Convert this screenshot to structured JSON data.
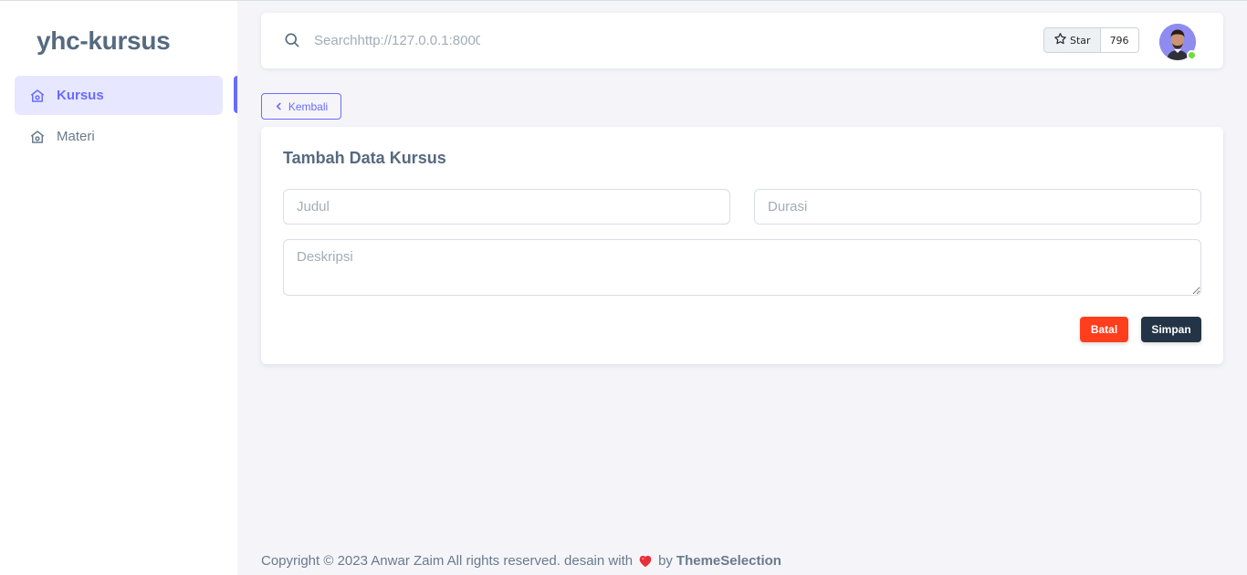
{
  "brand": "yhc-kursus",
  "sidebar": {
    "items": [
      {
        "label": "Kursus",
        "icon": "home-icon",
        "active": true
      },
      {
        "label": "Materi",
        "icon": "home-icon",
        "active": false
      }
    ]
  },
  "navbar": {
    "search_placeholder": "Searchhttp://127.0.0.1:8000",
    "star_label": "Star",
    "star_count": "796"
  },
  "back_button": "Kembali",
  "form": {
    "title": "Tambah Data Kursus",
    "judul_placeholder": "Judul",
    "durasi_placeholder": "Durasi",
    "deskripsi_placeholder": "Deskripsi",
    "cancel_label": "Batal",
    "save_label": "Simpan"
  },
  "footer": {
    "text_before": "Copyright © 2023 Anwar Zaim All rights reserved. desain with",
    "text_by": "by",
    "brand_link": "ThemeSelection"
  },
  "colors": {
    "primary": "#696cff",
    "danger": "#ff3e1d",
    "dark": "#233446",
    "online": "#71dd37"
  }
}
